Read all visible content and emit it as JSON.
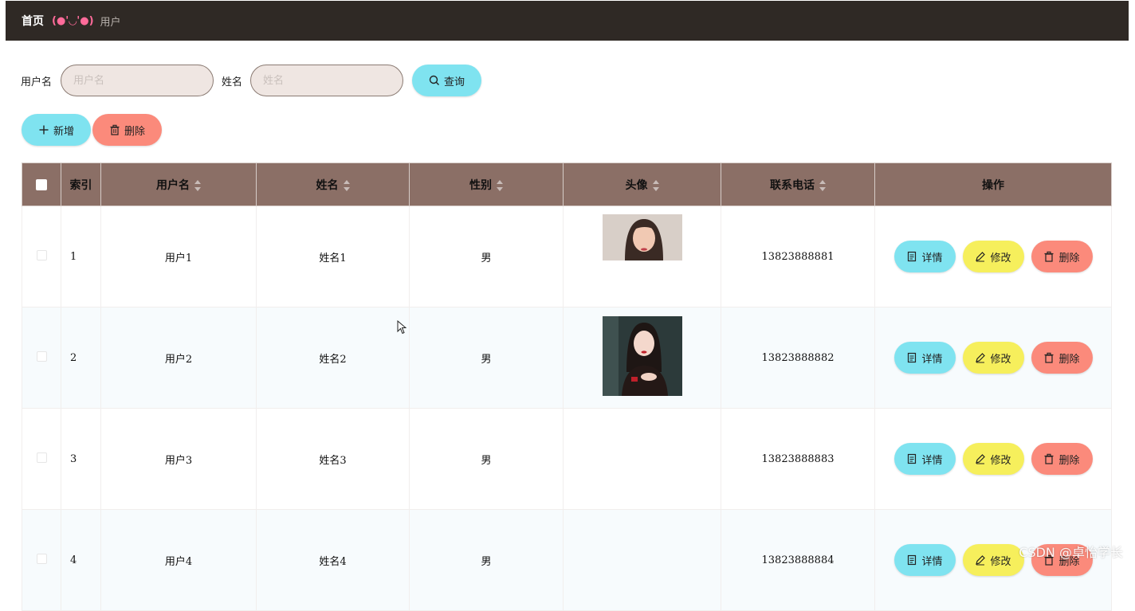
{
  "breadcrumb": {
    "home": "首页",
    "separator": "(●'◡'●)",
    "current": "用户"
  },
  "search": {
    "username_label": "用户名",
    "username_placeholder": "用户名",
    "name_label": "姓名",
    "name_placeholder": "姓名",
    "query_label": "查询"
  },
  "actions": {
    "add_label": "新增",
    "delete_label": "删除"
  },
  "colors": {
    "topbar": "#2f2925",
    "header": "#8b6f66",
    "cyan": "#7fe3f0",
    "red": "#fb8a7b",
    "yellow": "#f6ef5c",
    "input_bg": "#efe6e2"
  },
  "table": {
    "headers": {
      "index": "索引",
      "username": "用户名",
      "name": "姓名",
      "gender": "性别",
      "avatar": "头像",
      "phone": "联系电话",
      "ops": "操作"
    },
    "rows": [
      {
        "index": "1",
        "username": "用户1",
        "name": "姓名1",
        "gender": "男",
        "avatar": "avatar-photo-1",
        "phone": "13823888881"
      },
      {
        "index": "2",
        "username": "用户2",
        "name": "姓名2",
        "gender": "男",
        "avatar": "avatar-photo-2",
        "phone": "13823888882"
      },
      {
        "index": "3",
        "username": "用户3",
        "name": "姓名3",
        "gender": "男",
        "avatar": "",
        "phone": "13823888883"
      },
      {
        "index": "4",
        "username": "用户4",
        "name": "姓名4",
        "gender": "男",
        "avatar": "",
        "phone": "13823888884"
      }
    ],
    "row_buttons": {
      "detail": "详情",
      "edit": "修改",
      "delete": "删除"
    }
  },
  "watermark": "CSDN @卓怡学长"
}
